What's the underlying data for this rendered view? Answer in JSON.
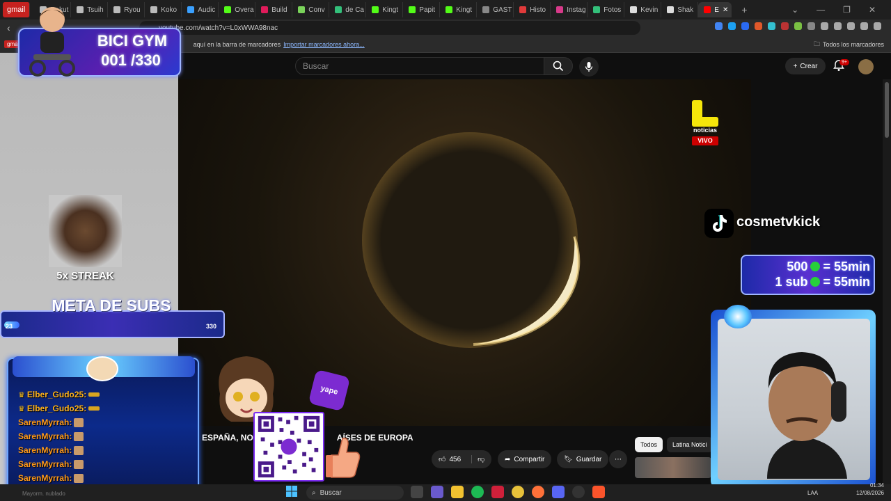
{
  "browser": {
    "gmail_tab": "gmail",
    "tabs": [
      {
        "label": "Rakut",
        "color": "#bbbbbb"
      },
      {
        "label": "Tsuih",
        "color": "#bbbbbb"
      },
      {
        "label": "Ryou",
        "color": "#bbbbbb"
      },
      {
        "label": "Koko",
        "color": "#bbbbbb"
      },
      {
        "label": "Audic",
        "color": "#3aa0ff"
      },
      {
        "label": "Overa",
        "color": "#53fc18"
      },
      {
        "label": "Build",
        "color": "#e01b5a"
      },
      {
        "label": "Conv",
        "color": "#7ad35a"
      },
      {
        "label": "de Ca",
        "color": "#33c07a"
      },
      {
        "label": "Kingt",
        "color": "#53fc18"
      },
      {
        "label": "Papit",
        "color": "#53fc18"
      },
      {
        "label": "Kingt",
        "color": "#53fc18"
      },
      {
        "label": "GAST",
        "color": "#888888"
      },
      {
        "label": "Histo",
        "color": "#e03a3a"
      },
      {
        "label": "Instag",
        "color": "#d83a8a"
      },
      {
        "label": "Fotos",
        "color": "#33c07a"
      },
      {
        "label": "Kevin",
        "color": "#dddddd"
      },
      {
        "label": "Shak",
        "color": "#dddddd"
      }
    ],
    "active_tab_label": "E",
    "url": "youtube.com/watch?v=L0xWWA98nac",
    "bookmarks_hint": "aquí en la barra de marcadores",
    "bookmarks_import": "Importar marcadores ahora...",
    "all_bookmarks": "Todos los marcadores"
  },
  "youtube": {
    "search_placeholder": "Buscar",
    "create_label": "Crear",
    "notif_count": "9+",
    "channel_logo_text": "noticias",
    "live_label": "VIVO",
    "video_title": "ESPAÑA, NO",
    "video_title_tail": "AÍSES DE EUROPA",
    "like_count": "456",
    "share_label": "Compartir",
    "save_label": "Guardar",
    "chips": [
      "Todos",
      "Latina Notici"
    ]
  },
  "overlay": {
    "bici_title": "BICI GYM",
    "bici_count": "001 /330",
    "streak_text": "5x STREAK",
    "meta_title": "META DE SUBS",
    "meta_start": "23",
    "meta_end": "330",
    "meta_progress": 0.07,
    "chat": [
      {
        "user": "Elber_Gudo25:",
        "color": "#ffb31a",
        "crown": true
      },
      {
        "user": "Elber_Gudo25:",
        "color": "#ffb31a",
        "crown": true
      },
      {
        "user": "SarenMyrrah:",
        "color": "#ff9a1a",
        "crown": false
      },
      {
        "user": "SarenMyrrah:",
        "color": "#ff9a1a",
        "crown": false
      },
      {
        "user": "SarenMyrrah:",
        "color": "#ff9a1a",
        "crown": false
      },
      {
        "user": "SarenMyrrah:",
        "color": "#ff9a1a",
        "crown": false
      },
      {
        "user": "SarenMyrrah:",
        "color": "#ff9a1a",
        "crown": false
      }
    ],
    "yape_label": "yape",
    "tiktok_name": "cosmetvkick",
    "kick_line1": "500",
    "kick_line1_tail": "= 55min",
    "kick_line2": "1 sub",
    "kick_line2_tail": "= 55min"
  },
  "taskbar": {
    "search_label": "Buscar",
    "left_label": "Mayorm. nublado",
    "lang": "LAA",
    "time": "01:34",
    "date": "12/08/2026"
  },
  "colors": {
    "accent_blue": "#1d2aa8",
    "kick_green": "#53fc18",
    "live_red": "#cc0000"
  }
}
